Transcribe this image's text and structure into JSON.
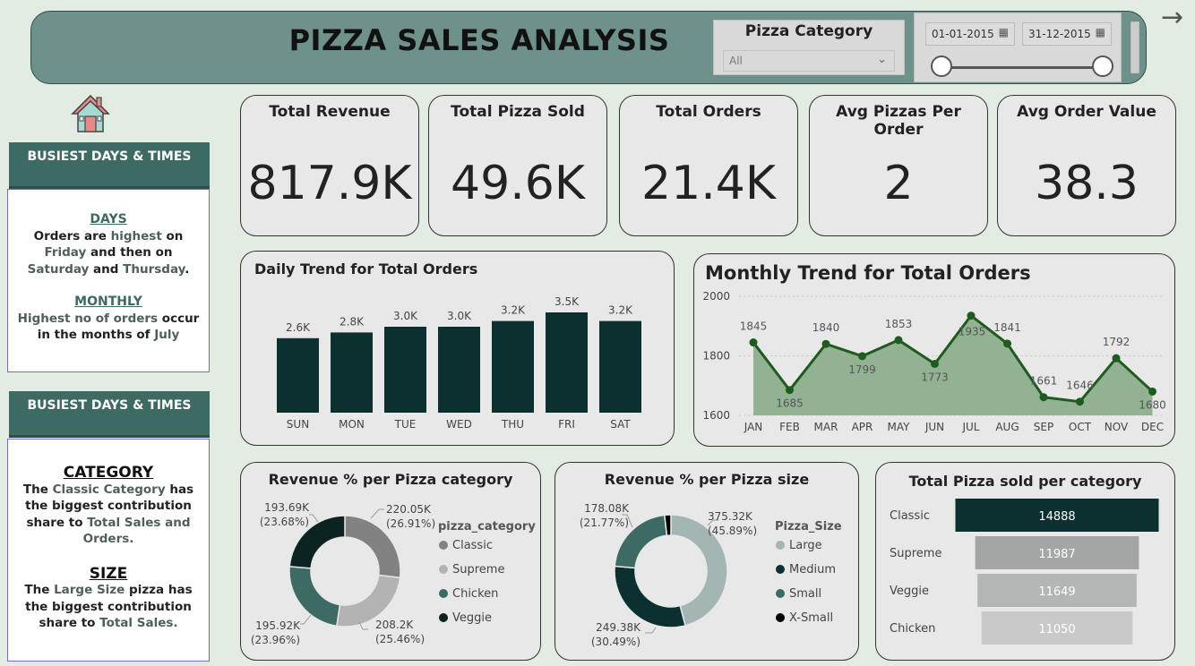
{
  "header": {
    "title": "PIZZA SALES ANALYSIS",
    "category_filter": {
      "label": "Pizza Category",
      "selected": "All"
    },
    "date_range": {
      "start": "01-01-2015",
      "end": "31-12-2015"
    }
  },
  "kpis": [
    {
      "label": "Total Revenue",
      "value": "817.9K"
    },
    {
      "label": "Total Pizza Sold",
      "value": "49.6K"
    },
    {
      "label": "Total Orders",
      "value": "21.4K"
    },
    {
      "label": "Avg Pizzas Per Order",
      "value": "2"
    },
    {
      "label": "Avg Order Value",
      "value": "38.3"
    }
  ],
  "sidebar": {
    "panel1": {
      "heading": "BUSIEST DAYS & TIMES",
      "days_title": "DAYS",
      "days_text": [
        "Orders are ",
        "highest",
        " on ",
        "Friday",
        " and then on ",
        "Saturday",
        " and ",
        "Thursday",
        "."
      ],
      "monthly_title": "MONTHLY",
      "monthly_text": [
        "Highest no of orders",
        " occur in the months of ",
        "July"
      ]
    },
    "panel2": {
      "heading": "BUSIEST DAYS & TIMES",
      "category_title": "CATEGORY",
      "category_text": [
        "The ",
        "Classic Category",
        " has the biggest contribution share to ",
        "Total Sales and Orders."
      ],
      "size_title": "SIZE",
      "size_text": [
        "The ",
        "Large Size",
        " pizza has the biggest contribution share to ",
        "Total Sales."
      ]
    }
  },
  "colors": {
    "dark": "#0b302f",
    "mid": "#3d6a63",
    "light_grey": "#b3b3b3",
    "grey": "#828282",
    "line": "#1e5b1e",
    "area": "#8aac8a"
  },
  "chart_data": [
    {
      "type": "bar",
      "title": "Daily Trend for Total Orders",
      "categories": [
        "SUN",
        "MON",
        "TUE",
        "WED",
        "THU",
        "FRI",
        "SAT"
      ],
      "values": [
        2.6,
        2.8,
        3.0,
        3.0,
        3.2,
        3.5,
        3.2
      ],
      "data_labels": [
        "2.6K",
        "2.8K",
        "3.0K",
        "3.0K",
        "3.2K",
        "3.5K",
        "3.2K"
      ],
      "ylim": [
        0,
        3.5
      ]
    },
    {
      "type": "area",
      "title": "Monthly Trend for Total Orders",
      "categories": [
        "JAN",
        "FEB",
        "MAR",
        "APR",
        "MAY",
        "JUN",
        "JUL",
        "AUG",
        "SEP",
        "OCT",
        "NOV",
        "DEC"
      ],
      "values": [
        1845,
        1685,
        1840,
        1799,
        1853,
        1773,
        1935,
        1841,
        1661,
        1646,
        1792,
        1680
      ],
      "yticks": [
        "2000",
        "1800",
        "1600"
      ],
      "ylim": [
        1600,
        2000
      ],
      "grid": true
    },
    {
      "type": "pie",
      "title": "Revenue % per Pizza category",
      "legend_title": "pizza_category",
      "labels": [
        "Classic",
        "Supreme",
        "Chicken",
        "Veggie"
      ],
      "values": [
        220.05,
        208.2,
        195.92,
        193.69
      ],
      "value_labels": [
        "220.05K",
        "208.2K",
        "195.92K",
        "193.69K"
      ],
      "percent_labels": [
        "(26.91%)",
        "(25.46%)",
        "(23.96%)",
        "(23.68%)"
      ],
      "colors": [
        "#828282",
        "#b3b3b3",
        "#3d6a63",
        "#0b2321"
      ]
    },
    {
      "type": "pie",
      "title": "Revenue % per Pizza size",
      "legend_title": "Pizza_Size",
      "labels": [
        "Large",
        "Medium",
        "Small",
        "X-Small"
      ],
      "values": [
        375.32,
        249.38,
        178.08,
        14.85
      ],
      "value_labels": [
        "375.32K",
        "249.38K",
        "178.08K",
        ""
      ],
      "percent_labels": [
        "(45.89%)",
        "(30.49%)",
        "(21.77%)",
        ""
      ],
      "colors": [
        "#a3b6b3",
        "#0b302f",
        "#3d6a63",
        "#000000"
      ]
    },
    {
      "type": "bar",
      "title": "Total Pizza sold per category",
      "categories": [
        "Classic",
        "Supreme",
        "Veggie",
        "Chicken"
      ],
      "values": [
        14888,
        11987,
        11649,
        11050
      ],
      "data_labels": [
        "14888",
        "11987",
        "11649",
        "11050"
      ],
      "colors": [
        "#0b302f",
        "#a3a6a5",
        "#b3b6b5",
        "#c9c9c9"
      ]
    }
  ]
}
